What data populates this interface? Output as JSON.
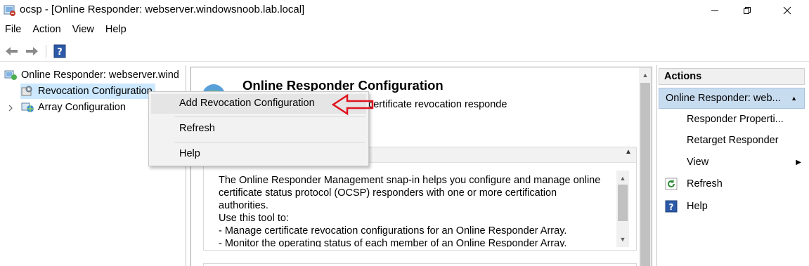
{
  "window": {
    "title": "ocsp - [Online Responder: webserver.windowsnoob.lab.local]",
    "minimize_label": "minimize",
    "maximize_label": "restore",
    "close_label": "close"
  },
  "menu": [
    "File",
    "Action",
    "View",
    "Help"
  ],
  "toolbar": {
    "back_icon": "back-arrow-icon",
    "forward_icon": "forward-arrow-icon",
    "help_icon": "help-icon"
  },
  "tree": {
    "root": "Online Responder: webserver.wind",
    "items": [
      {
        "label": "Revocation Configuration",
        "selected": true
      },
      {
        "label": "Array Configuration",
        "selected": false
      }
    ]
  },
  "center": {
    "title": "Online Responder Configuration",
    "subtitle": "e and manage one or more certificate revocation responde",
    "description": [
      "The Online Responder Management snap-in helps you configure and manage online",
      "certificate status protocol (OCSP) responders with one or more certification",
      "authorities.",
      "Use this tool to:",
      "-  Manage certificate revocation configurations for an Online Responder Array.",
      "-  Monitor the operating status of each member of an Online Responder Array."
    ]
  },
  "actions": {
    "header": "Actions",
    "group": "Online Responder: web...",
    "items": [
      {
        "label": "Responder Properti...",
        "icon": ""
      },
      {
        "label": "Retarget Responder",
        "icon": ""
      },
      {
        "label": "View",
        "icon": "",
        "submenu": true
      },
      {
        "label": "Refresh",
        "icon": "refresh-icon"
      },
      {
        "label": "Help",
        "icon": "help-icon"
      }
    ]
  },
  "context_menu": {
    "items": [
      "Add Revocation Configuration",
      "Refresh",
      "Help"
    ]
  },
  "colors": {
    "selection": "#cce8ff",
    "actions_group": "#c8dcf0",
    "annotation_arrow": "#e0141e"
  }
}
